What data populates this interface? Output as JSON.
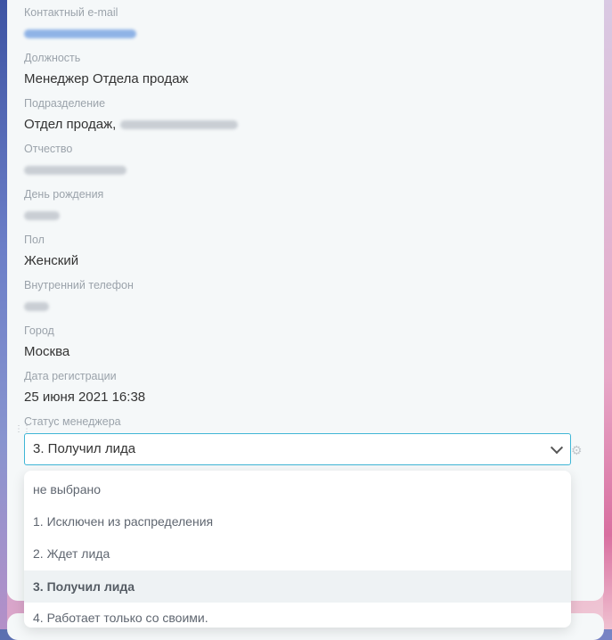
{
  "fields": [
    {
      "label": "Контактный e-mail",
      "value": ""
    },
    {
      "label": "Должность",
      "value": "Менеджер Отдела продаж"
    },
    {
      "label": "Подразделение",
      "value": "Отдел продаж,"
    },
    {
      "label": "Отчество",
      "value": ""
    },
    {
      "label": "День рождения",
      "value": ""
    },
    {
      "label": "Пол",
      "value": "Женский"
    },
    {
      "label": "Внутренний телефон",
      "value": ""
    },
    {
      "label": "Город",
      "value": "Москва"
    },
    {
      "label": "Дата регистрации",
      "value": "25 июня 2021 16:38"
    }
  ],
  "status": {
    "label": "Статус менеджера",
    "selected": "3. Получил лида",
    "options": [
      "не выбрано",
      "1. Исключен из распределения",
      "2. Ждет лида",
      "3. Получил лида",
      "4. Работает только со своими."
    ]
  },
  "icons": {
    "drag": "drag-handle-icon",
    "gear": "gear-icon",
    "chevron": "chevron-down-icon"
  }
}
